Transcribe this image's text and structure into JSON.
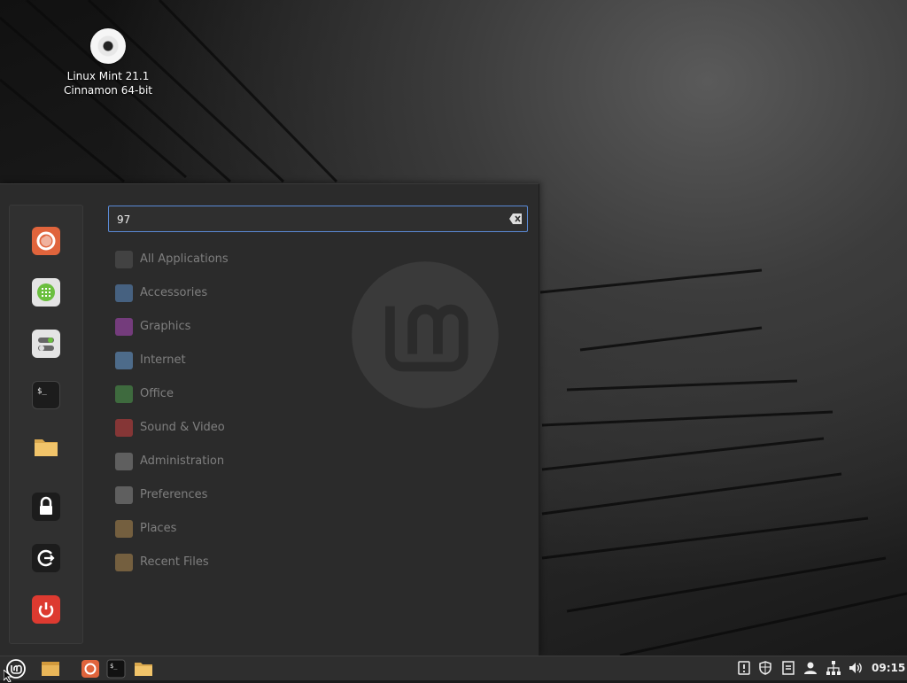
{
  "desktop": {
    "icon_line1": "Linux Mint 21.1",
    "icon_line2": "Cinnamon 64-bit"
  },
  "menu": {
    "search": {
      "value": "97"
    },
    "favorites": [
      {
        "name": "firefox",
        "icon": "firefox-icon"
      },
      {
        "name": "software-manager",
        "icon": "software-manager-icon"
      },
      {
        "name": "settings",
        "icon": "system-settings-icon"
      },
      {
        "name": "terminal",
        "icon": "terminal-icon"
      },
      {
        "name": "files",
        "icon": "folder-icon"
      }
    ],
    "session": [
      {
        "name": "lock-screen",
        "icon": "lock-icon"
      },
      {
        "name": "logout",
        "icon": "logout-icon"
      },
      {
        "name": "quit",
        "icon": "power-icon"
      }
    ],
    "categories": [
      {
        "label": "All Applications",
        "icon": "grid-icon",
        "color": "#555555"
      },
      {
        "label": "Accessories",
        "icon": "scissors-icon",
        "color": "#5c8ec7"
      },
      {
        "label": "Graphics",
        "icon": "graphics-icon",
        "color": "#b04ac0"
      },
      {
        "label": "Internet",
        "icon": "cloud-icon",
        "color": "#6aa0d8"
      },
      {
        "label": "Office",
        "icon": "office-icon",
        "color": "#4f9e4f"
      },
      {
        "label": "Sound & Video",
        "icon": "play-icon",
        "color": "#d04040"
      },
      {
        "label": "Administration",
        "icon": "administration-icon",
        "color": "#8a8a8a"
      },
      {
        "label": "Preferences",
        "icon": "preferences-icon",
        "color": "#8a8a8a"
      },
      {
        "label": "Places",
        "icon": "folder-icon",
        "color": "#b08a50"
      },
      {
        "label": "Recent Files",
        "icon": "recent-folder-icon",
        "color": "#b08a50"
      }
    ]
  },
  "panel": {
    "clock": "09:15",
    "launchers": [
      "show-desktop",
      "firefox",
      "terminal",
      "files"
    ],
    "tray": [
      "notifications-icon",
      "update-manager-icon",
      "clipboard-icon",
      "user-icon",
      "network-icon",
      "volume-icon"
    ]
  }
}
